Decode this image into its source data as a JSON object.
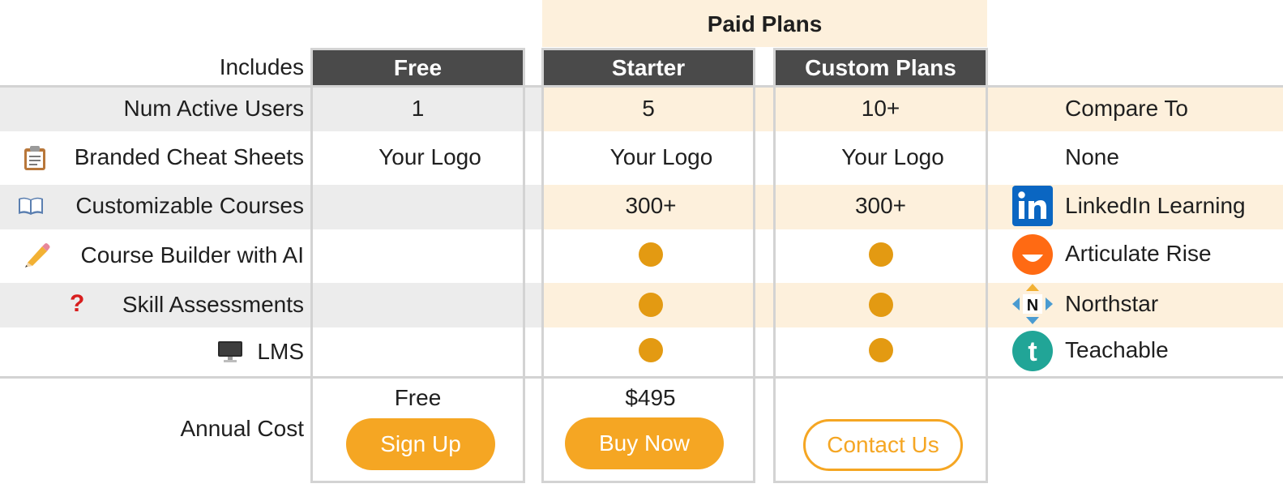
{
  "header": {
    "paid_plans": "Paid Plans",
    "includes": "Includes",
    "compare_to": "Compare To"
  },
  "plans": [
    {
      "name": "Free",
      "active_users": "1",
      "cheat_sheets": "Your Logo",
      "courses": "",
      "course_builder": false,
      "assessments": false,
      "lms": false,
      "cost": "Free",
      "cta": "Sign Up",
      "cta_style": "solid"
    },
    {
      "name": "Starter",
      "active_users": "5",
      "cheat_sheets": "Your Logo",
      "courses": "300+",
      "course_builder": true,
      "assessments": true,
      "lms": true,
      "cost": "$495",
      "cta": "Buy Now",
      "cta_style": "solid"
    },
    {
      "name": "Custom Plans",
      "active_users": "10+",
      "cheat_sheets": "Your Logo",
      "courses": "300+",
      "course_builder": true,
      "assessments": true,
      "lms": true,
      "cost": "",
      "cta": "Contact Us",
      "cta_style": "outline"
    }
  ],
  "rows": [
    {
      "label": "Num Active Users",
      "icon": "",
      "compare": "",
      "compare_icon": ""
    },
    {
      "label": "Branded Cheat Sheets",
      "icon": "clipboard-icon",
      "compare": "None",
      "compare_icon": ""
    },
    {
      "label": "Customizable Courses",
      "icon": "open-book-icon",
      "compare": "LinkedIn Learning",
      "compare_icon": "linkedin-logo"
    },
    {
      "label": "Course Builder with AI",
      "icon": "pencil-icon",
      "compare": "Articulate Rise",
      "compare_icon": "articulate-logo"
    },
    {
      "label": "Skill Assessments",
      "icon": "question-mark-icon",
      "compare": "Northstar",
      "compare_icon": "northstar-logo"
    },
    {
      "label": "LMS",
      "icon": "desktop-computer-icon",
      "compare": "Teachable",
      "compare_icon": "teachable-logo"
    }
  ],
  "annual_cost_label": "Annual Cost",
  "colors": {
    "header_bg": "#4a4a4a",
    "accent": "#f5a623",
    "dot": "#e39a12",
    "cream": "#fdf0dc",
    "gray_band": "#ececec",
    "linkedin": "#0a66c2",
    "articulate": "#ff6a13",
    "teachable": "#21a597"
  }
}
